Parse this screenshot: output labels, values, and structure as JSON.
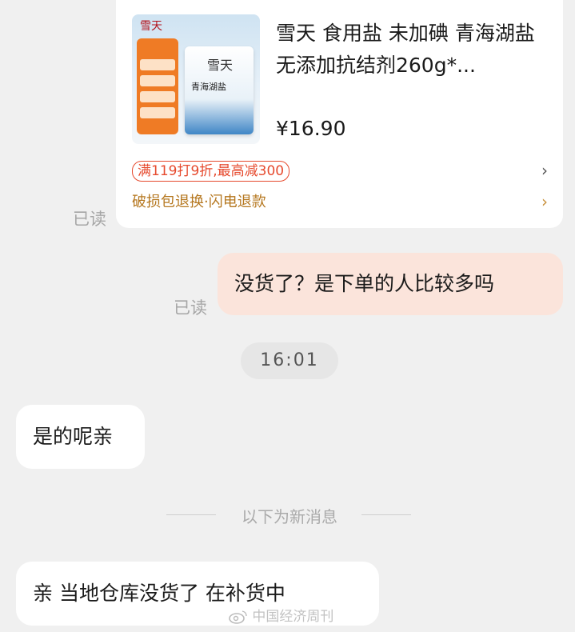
{
  "product_card": {
    "title": "雪天  食用盐  未加碘  青海湖盐无添加抗结剂260g*...",
    "price": "¥16.90",
    "promo": "满119打9折,最高减300",
    "service": "破损包退换·闪电退款",
    "image": {
      "brand_logo": "雪天",
      "pack_title": "青海湖盐",
      "pack_logo": "雪天"
    }
  },
  "read_status_1": "已读",
  "read_status_2": "已读",
  "messages": {
    "outgoing_1": "没货了？是下单的人比较多吗",
    "incoming_1": "是的呢亲",
    "incoming_2": "亲  当地仓库没货了  在补货中"
  },
  "timestamp": "16:01",
  "new_messages_divider": "以下为新消息",
  "watermark": "中国经济周刊",
  "colors": {
    "background": "#f0f0f0",
    "outgoing_bubble": "#fbe4db",
    "incoming_bubble": "#ffffff",
    "promo_accent": "#e64a2e",
    "service_accent": "#b5771f"
  }
}
